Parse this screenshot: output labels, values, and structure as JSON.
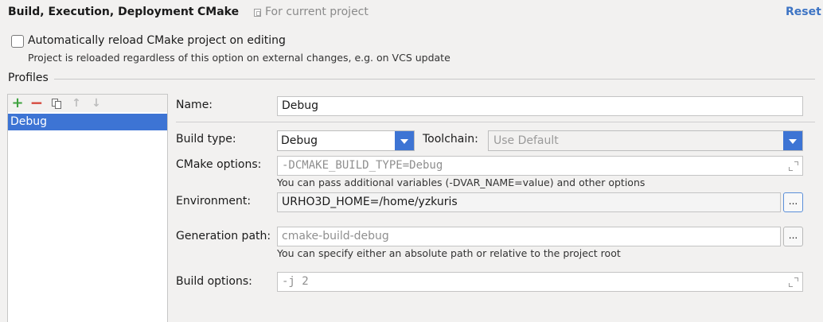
{
  "header": {
    "breadcrumb_parent": "Build, Execution, Deployment",
    "breadcrumb_separator": "›",
    "breadcrumb_current": "CMake",
    "scope_label": "For current project",
    "reset_label": "Reset"
  },
  "auto_reload": {
    "label": "Automatically reload CMake project on editing",
    "hint": "Project is reloaded regardless of this option on external changes, e.g. on VCS update",
    "checked": false
  },
  "profiles": {
    "title": "Profiles",
    "toolbar": {
      "add": "+",
      "remove": "−",
      "up": "↑",
      "down": "↓"
    },
    "items": [
      {
        "label": "Debug",
        "selected": true
      }
    ]
  },
  "form": {
    "name_label": "Name:",
    "name_value": "Debug",
    "build_type_label": "Build type:",
    "build_type_value": "Debug",
    "toolchain_label": "Toolchain:",
    "toolchain_value": "Use Default",
    "cmake_options_label": "CMake options:",
    "cmake_options_placeholder": "-DCMAKE_BUILD_TYPE=Debug",
    "cmake_options_hint": "You can pass additional variables (-DVAR_NAME=value) and other options",
    "environment_label": "Environment:",
    "environment_value": "URHO3D_HOME=/home/yzkuris",
    "environment_button": "...",
    "generation_path_label": "Generation path:",
    "generation_path_placeholder": "cmake-build-debug",
    "generation_path_button": "...",
    "generation_path_hint": "You can specify either an absolute path or relative to the project root",
    "build_options_label": "Build options:",
    "build_options_placeholder": "-j 2"
  },
  "colors": {
    "accent": "#3d74d4",
    "link": "#3d74c4",
    "background": "#f2f1f0"
  }
}
